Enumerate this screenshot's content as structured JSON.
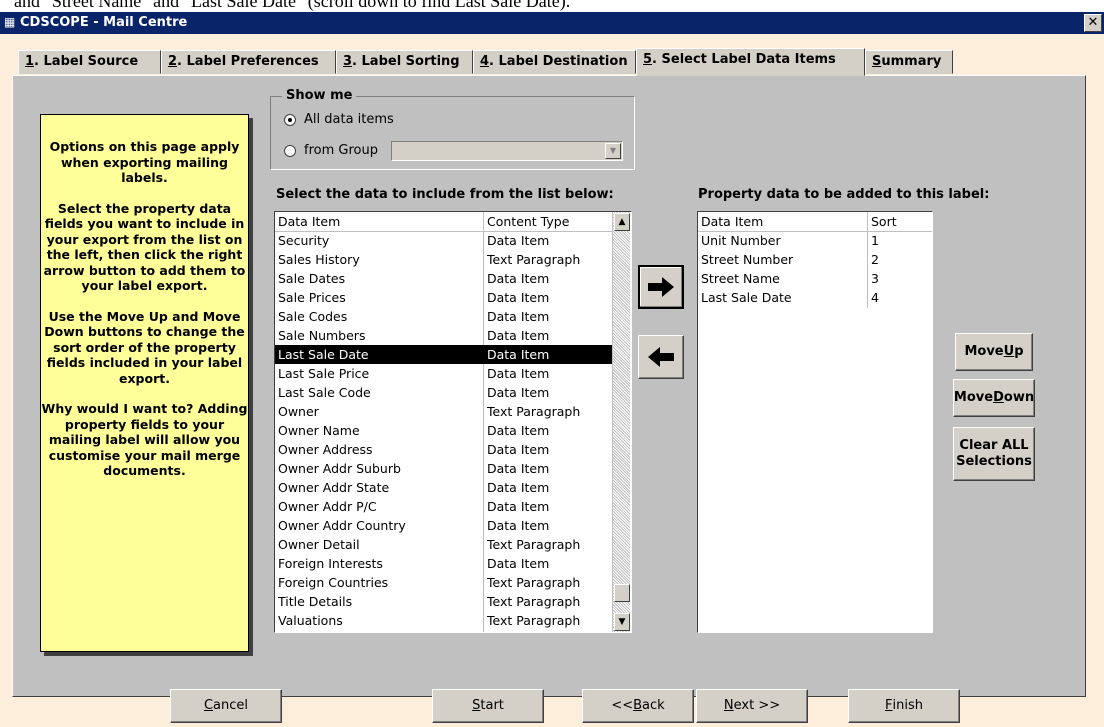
{
  "doc_caption": "and \"Street Name\" and \"Last Sale Date\" (scroll down to find Last Sale Date).",
  "window": {
    "title": "CDSCOPE - Mail Centre"
  },
  "tabs": [
    {
      "num": "1",
      "label": ". Label Source"
    },
    {
      "num": "2",
      "label": ". Label Preferences"
    },
    {
      "num": "3",
      "label": ". Label Sorting"
    },
    {
      "num": "4",
      "label": ". Label Destination"
    },
    {
      "num": "5",
      "label": ". Select Label Data Items"
    },
    {
      "num": "S",
      "label": "ummary"
    }
  ],
  "help_text": [
    "Options on this page apply when exporting mailing labels.",
    "Select the property data fields you want to include in your export from the list on the left, then click the right arrow button to add them to your label export.",
    "Use the Move Up and Move Down buttons to change the sort order of the property fields included in your label export.",
    "Why would I want to? Adding property fields to your mailing label will allow you customise your mail merge documents."
  ],
  "show_me": {
    "label": "Show me",
    "option_all": "All data items",
    "option_group": "from Group",
    "selected": "all",
    "group_value": ""
  },
  "left_list": {
    "heading": "Select the data to include from the list below:",
    "columns": [
      "Data Item",
      "Content Type"
    ],
    "rows": [
      [
        "Security",
        "Data Item"
      ],
      [
        "Sales History",
        "Text Paragraph"
      ],
      [
        "Sale Dates",
        "Data Item"
      ],
      [
        "Sale Prices",
        "Data Item"
      ],
      [
        "Sale Codes",
        "Data Item"
      ],
      [
        "Sale Numbers",
        "Data Item"
      ],
      [
        "Last Sale Date",
        "Data Item"
      ],
      [
        "Last Sale Price",
        "Data Item"
      ],
      [
        "Last Sale Code",
        "Data Item"
      ],
      [
        "Owner",
        "Text Paragraph"
      ],
      [
        "Owner Name",
        "Data Item"
      ],
      [
        "Owner Address",
        "Data Item"
      ],
      [
        "Owner Addr Suburb",
        "Data Item"
      ],
      [
        "Owner Addr State",
        "Data Item"
      ],
      [
        "Owner Addr P/C",
        "Data Item"
      ],
      [
        "Owner Addr Country",
        "Data Item"
      ],
      [
        "Owner Detail",
        "Text Paragraph"
      ],
      [
        "Foreign Interests",
        "Data Item"
      ],
      [
        "Foreign Countries",
        "Text Paragraph"
      ],
      [
        "Title Details",
        "Text Paragraph"
      ],
      [
        "Valuations",
        "Text Paragraph"
      ]
    ],
    "selected_index": 6
  },
  "right_list": {
    "heading": "Property data to be added to this label:",
    "columns": [
      "Data Item",
      "Sort"
    ],
    "rows": [
      [
        "Unit Number",
        "1"
      ],
      [
        "Street Number",
        "2"
      ],
      [
        "Street Name",
        "3"
      ],
      [
        "Last Sale Date",
        "4"
      ]
    ]
  },
  "buttons": {
    "move_up": {
      "pre": "Move ",
      "key": "U",
      "post": "p"
    },
    "move_down": {
      "pre": "Move ",
      "key": "D",
      "post": "own"
    },
    "clear_all": "Clear ALL Selections",
    "cancel": {
      "key": "C",
      "post": "ancel"
    },
    "start": {
      "key": "S",
      "post": "tart"
    },
    "back": {
      "pre": "<< ",
      "key": "B",
      "post": "ack"
    },
    "next": {
      "key": "N",
      "post": "ext >>"
    },
    "finish": {
      "key": "F",
      "post": "inish"
    }
  },
  "icons": {
    "add": "right-arrow-icon",
    "remove": "left-arrow-icon",
    "window": "form-icon",
    "close": "close-icon"
  }
}
